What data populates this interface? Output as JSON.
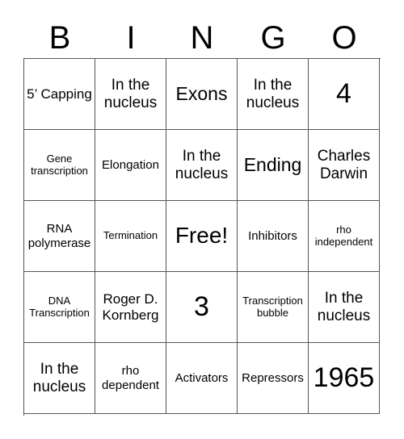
{
  "header": [
    "B",
    "I",
    "N",
    "G",
    "O"
  ],
  "rows": [
    [
      "5’ Capping",
      "In the nucleus",
      "Exons",
      "In the nucleus",
      "4"
    ],
    [
      "Gene transcription",
      "Elongation",
      "In the nucleus",
      "Ending",
      "Charles Darwin"
    ],
    [
      "RNA polymerase",
      "Termination",
      "Free!",
      "Inhibitors",
      "rho independent"
    ],
    [
      "DNA Transcription",
      "Roger D. Kornberg",
      "3",
      "Transcription bubble",
      "In the nucleus"
    ],
    [
      "In the nucleus",
      "rho dependent",
      "Activators",
      "Repressors",
      "1965"
    ]
  ]
}
